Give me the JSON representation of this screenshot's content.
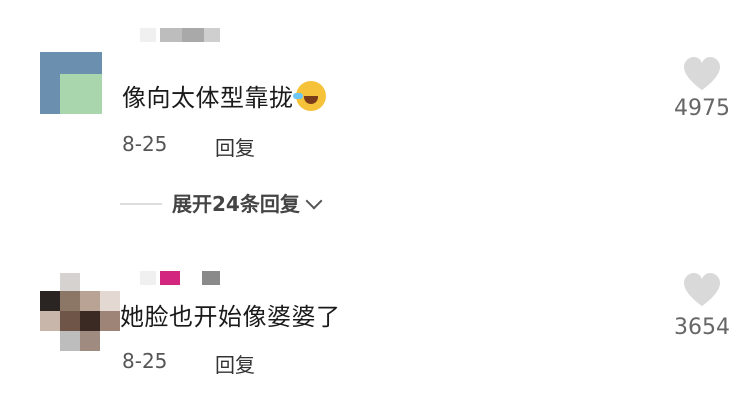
{
  "comments": [
    {
      "text": "像向太体型靠拢",
      "emoji": "rofl-emoji",
      "date": "8-25",
      "reply_label": "回复",
      "likes": "4975",
      "expand_label": "展开24条回复"
    },
    {
      "text": "她脸也开始像婆婆了",
      "date": "8-25",
      "reply_label": "回复",
      "likes": "3654"
    }
  ],
  "colors": {
    "heart": "#d9d9d9",
    "text": "#1a1a1a",
    "meta": "#555555"
  }
}
